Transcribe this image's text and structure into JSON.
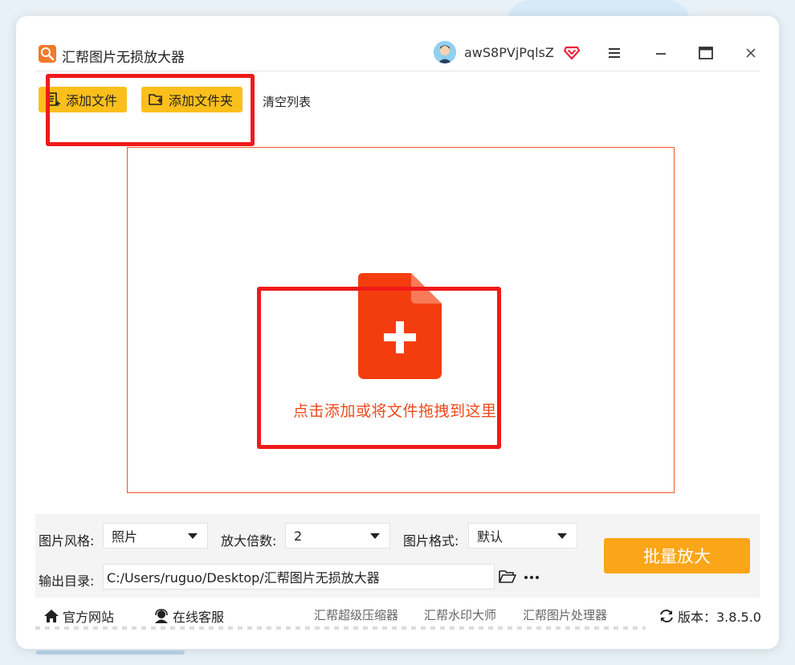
{
  "app": {
    "title": "汇帮图片无损放大器",
    "username": "awS8PVjPqlsZ",
    "icons": [
      "menu-icon",
      "minimize-icon",
      "maximize-icon",
      "close-icon"
    ]
  },
  "toolbar": {
    "add_file": "添加文件",
    "add_folder": "添加文件夹",
    "clear_list": "清空列表"
  },
  "drop_zone": {
    "hint": "点击添加或将文件拖拽到这里"
  },
  "settings": {
    "style_label": "图片风格:",
    "style_value": "照片",
    "scale_label": "放大倍数:",
    "scale_value": "2",
    "format_label": "图片格式:",
    "format_value": "默认",
    "output_label": "输出目录:",
    "output_path": "C:/Users/ruguo/Desktop/汇帮图片无损放大器",
    "batch_button": "批量放大"
  },
  "footer": {
    "website": "官方网站",
    "support": "在线客服",
    "app1": "汇帮超级压缩器",
    "app2": "汇帮水印大师",
    "app3": "汇帮图片处理器",
    "version": "版本：3.8.5.0"
  },
  "colors": {
    "accent_yellow": "#fbbf1c",
    "batch_orange": "#fba518",
    "drop_red": "#ef4a1d",
    "highlight_red": "#f01a1a"
  }
}
